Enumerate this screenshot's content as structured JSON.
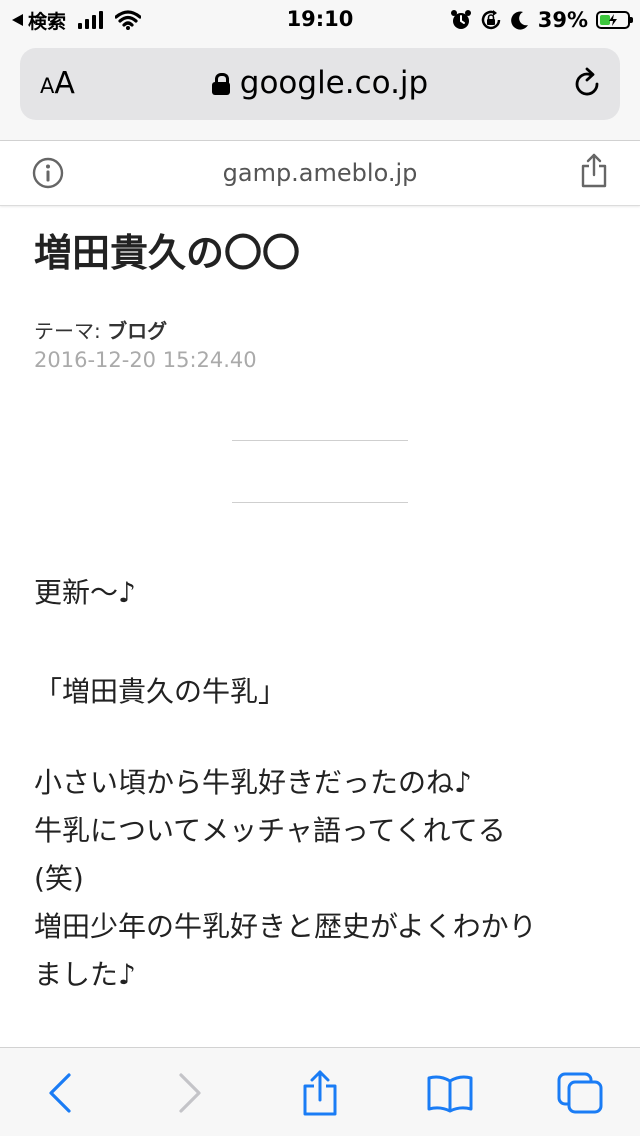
{
  "status_bar": {
    "back_label": "検索",
    "time": "19:10",
    "battery": "39%",
    "battery_level": 0.39
  },
  "browser": {
    "text_size_small": "A",
    "text_size_large": "A",
    "url": "google.co.jp",
    "amp_domain": "gamp.ameblo.jp"
  },
  "article": {
    "title": "増田貴久の〇〇",
    "theme_label": "テーマ: ",
    "theme_value": "ブログ",
    "date": "2016-12-20 15:24.40",
    "paragraph1": "更新〜♪",
    "paragraph2": "「増田貴久の牛乳」",
    "paragraph3_lines": [
      "小さい頃から牛乳好きだったのね♪",
      "牛乳についてメッチャ語ってくれてる",
      "(笑)",
      "増田少年の牛乳好きと歴史がよくわかり",
      "ました♪"
    ]
  },
  "colors": {
    "accent": "#1a7cf5",
    "disabled": "#c4c4c8",
    "battery_charge": "#3cc63c",
    "date_text": "#aaaaaa"
  },
  "icons": {
    "status": [
      "signal-icon",
      "wifi-icon",
      "alarm-icon",
      "rotation-lock-icon",
      "moon-icon",
      "battery-icon"
    ],
    "toolbar": [
      "back-icon",
      "forward-icon",
      "share-icon",
      "bookmarks-icon",
      "tabs-icon"
    ]
  }
}
